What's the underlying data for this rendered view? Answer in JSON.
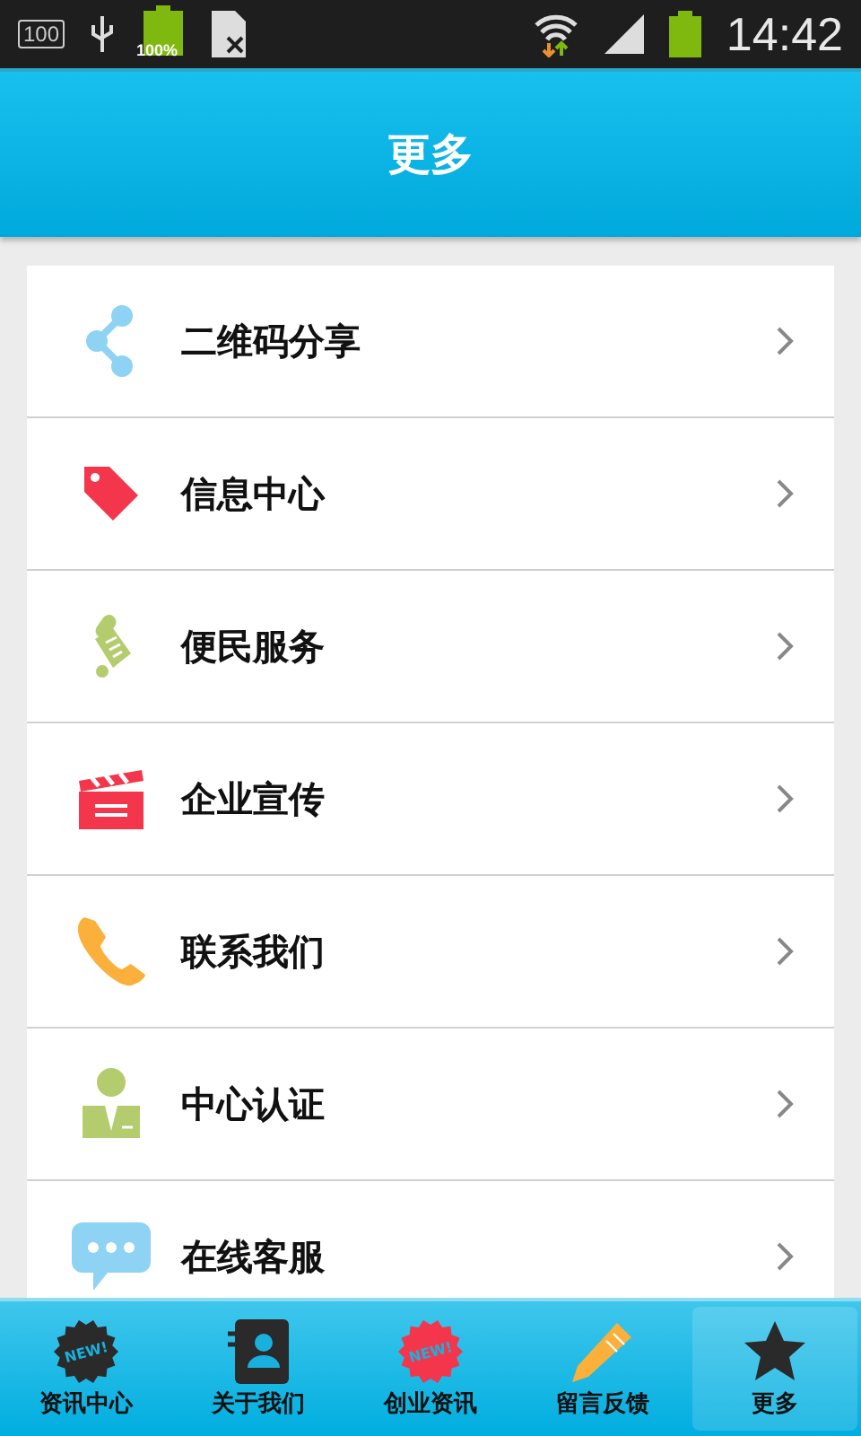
{
  "status_bar": {
    "storage": "100",
    "battery_percent": "100%",
    "time": "14:42"
  },
  "header": {
    "title": "更多"
  },
  "menu": [
    {
      "label": "二维码分享"
    },
    {
      "label": "信息中心"
    },
    {
      "label": "便民服务"
    },
    {
      "label": "企业宣传"
    },
    {
      "label": "联系我们"
    },
    {
      "label": "中心认证"
    },
    {
      "label": "在线客服"
    }
  ],
  "tabs": [
    {
      "label": "资讯中心",
      "badge": "NEW!",
      "selected": false
    },
    {
      "label": "关于我们",
      "selected": false
    },
    {
      "label": "创业资讯",
      "badge": "NEW!",
      "selected": false
    },
    {
      "label": "留言反馈",
      "selected": false
    },
    {
      "label": "更多",
      "selected": true
    }
  ]
}
